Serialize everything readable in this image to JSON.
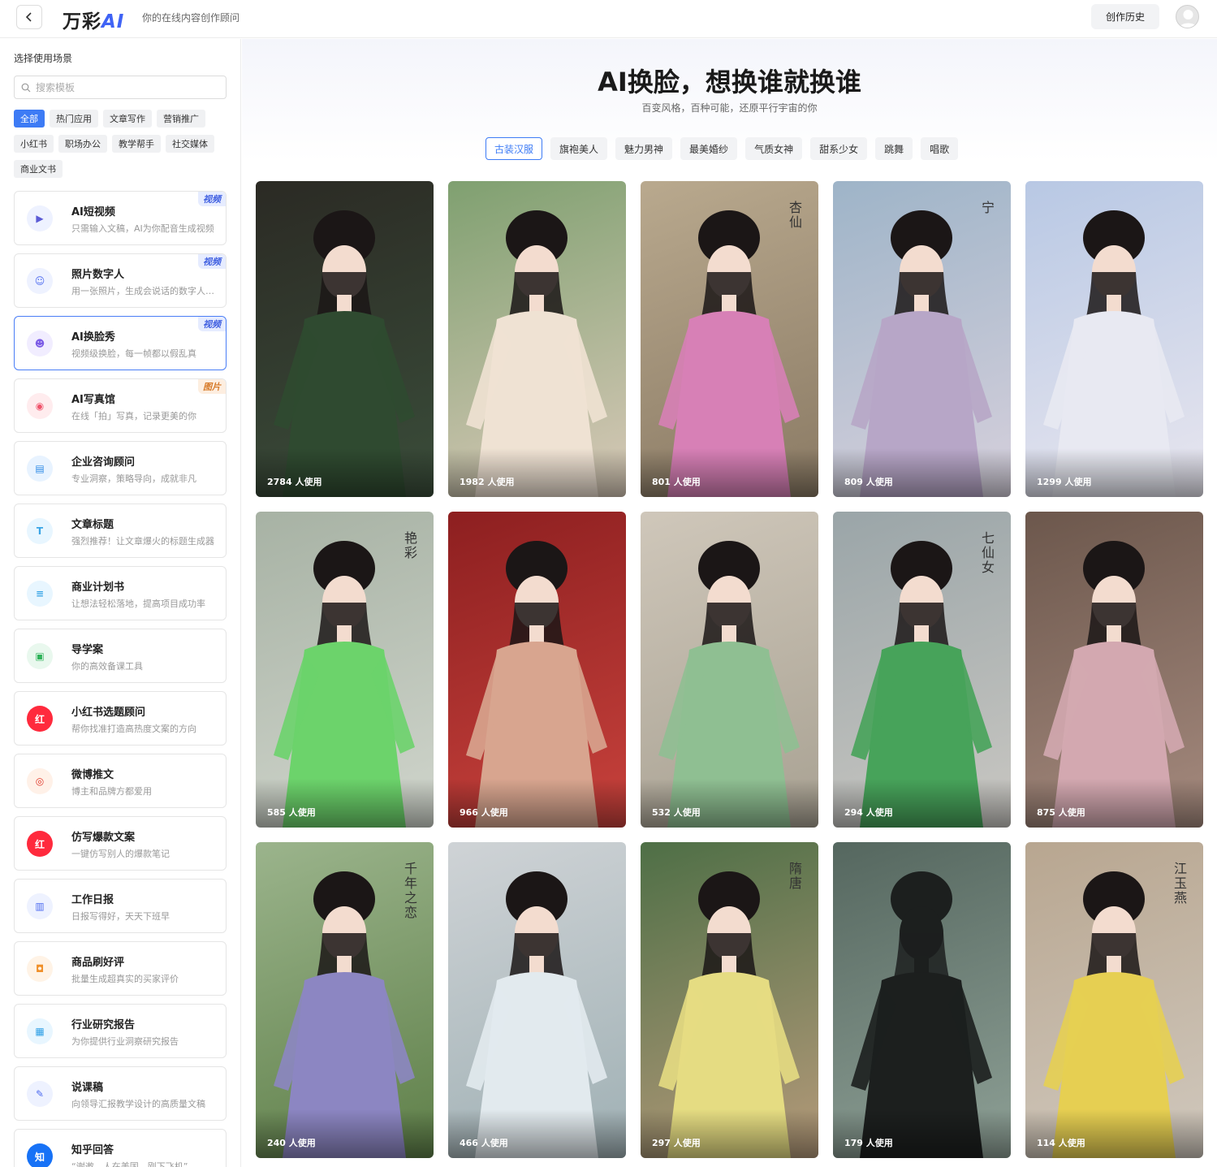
{
  "header": {
    "logo_text": "万彩",
    "logo_ai": "AI",
    "slogan": "你的在线内容创作顾问",
    "history_label": "创作历史"
  },
  "sidebar": {
    "title": "选择使用场景",
    "search_placeholder": "搜索模板",
    "filters": [
      "全部",
      "热门应用",
      "文章写作",
      "营销推广",
      "小红书",
      "职场办公",
      "教学帮手",
      "社交媒体",
      "商业文书"
    ],
    "active_filter": "全部",
    "cards": [
      {
        "title": "AI短视频",
        "desc": "只需输入文稿，AI为你配音生成视频",
        "badge": "视频",
        "icon": "play-icon"
      },
      {
        "title": "照片数字人",
        "desc": "用一张照片，生成会说话的数字人视...",
        "badge": "视频",
        "icon": "user-icon"
      },
      {
        "title": "AI换脸秀",
        "desc": "视频级换脸，每一帧都以假乱真",
        "badge": "视频",
        "icon": "face-icon"
      },
      {
        "title": "AI写真馆",
        "desc": "在线「拍」写真，记录更美的你",
        "badge": "图片",
        "icon": "camera-icon"
      },
      {
        "title": "企业咨询顾问",
        "desc": "专业洞察，策略导向，成就非凡",
        "badge": "",
        "icon": "briefcase-icon"
      },
      {
        "title": "文章标题",
        "desc": "强烈推荐！让文章爆火的标题生成器",
        "badge": "",
        "icon": "title-icon"
      },
      {
        "title": "商业计划书",
        "desc": "让想法轻松落地，提高项目成功率",
        "badge": "",
        "icon": "document-icon"
      },
      {
        "title": "导学案",
        "desc": "你的高效备课工具",
        "badge": "",
        "icon": "board-icon"
      },
      {
        "title": "小红书选题顾问",
        "desc": "帮你找准打造高热度文案的方向",
        "badge": "",
        "icon": "xiaohongshu-icon"
      },
      {
        "title": "微博推文",
        "desc": "博主和品牌方都爱用",
        "badge": "",
        "icon": "weibo-icon"
      },
      {
        "title": "仿写爆款文案",
        "desc": "一键仿写别人的爆款笔记",
        "badge": "",
        "icon": "xiaohongshu-icon"
      },
      {
        "title": "工作日报",
        "desc": "日报写得好，天天下班早",
        "badge": "",
        "icon": "report-icon"
      },
      {
        "title": "商品刷好评",
        "desc": "批量生成超真实的买家评价",
        "badge": "",
        "icon": "bag-icon"
      },
      {
        "title": "行业研究报告",
        "desc": "为你提供行业洞察研究报告",
        "badge": "",
        "icon": "research-icon"
      },
      {
        "title": "说课稿",
        "desc": "向领导汇报教学设计的高质量文稿",
        "badge": "",
        "icon": "teacher-icon"
      },
      {
        "title": "知乎回答",
        "desc": "“谢邀，人在美国，刚下飞机”",
        "badge": "",
        "icon": "zhihu-icon"
      }
    ]
  },
  "main": {
    "title": "AI换脸，想换谁就换谁",
    "subtitle": "百变风格，百种可能，还原平行宇宙的你",
    "tabs": [
      "古装汉服",
      "旗袍美人",
      "魅力男神",
      "最美婚纱",
      "气质女神",
      "甜系少女",
      "跳舞",
      "唱歌"
    ],
    "active_tab": "古装汉服",
    "tiles": [
      {
        "uses": "2784 人使用",
        "bg": [
          "#2b2a24",
          "#3a4d3a"
        ],
        "dress": "#2f4a30",
        "text": ""
      },
      {
        "uses": "1982 人使用",
        "bg": [
          "#7fa070",
          "#d8c9b8"
        ],
        "dress": "#efe2d3",
        "text": ""
      },
      {
        "uses": "801 人使用",
        "bg": [
          "#b9a98e",
          "#8a7a64"
        ],
        "dress": "#d780b6",
        "text": "杏仙"
      },
      {
        "uses": "809 人使用",
        "bg": [
          "#9eb4c8",
          "#d6d0dc"
        ],
        "dress": "#b7a6c7",
        "text": "宁"
      },
      {
        "uses": "1299 人使用",
        "bg": [
          "#b8c8e4",
          "#e8e6ef"
        ],
        "dress": "#e8e9f2",
        "text": ""
      },
      {
        "uses": "585 人使用",
        "bg": [
          "#a7b2a4",
          "#d0d5cc"
        ],
        "dress": "#6cd36b",
        "text": "艳彩"
      },
      {
        "uses": "966 人使用",
        "bg": [
          "#8d1f20",
          "#c8423c"
        ],
        "dress": "#d8a58f",
        "text": ""
      },
      {
        "uses": "532 人使用",
        "bg": [
          "#cfc7ba",
          "#a8a192"
        ],
        "dress": "#8fbf92",
        "text": ""
      },
      {
        "uses": "294 人使用",
        "bg": [
          "#9aa5a8",
          "#c9c7c2"
        ],
        "dress": "#47a35a",
        "text": "七仙女"
      },
      {
        "uses": "875 人使用",
        "bg": [
          "#6c574c",
          "#a58a7e"
        ],
        "dress": "#d3a8b0",
        "text": ""
      },
      {
        "uses": "240 人使用",
        "bg": [
          "#9bb48c",
          "#5e7f48"
        ],
        "dress": "#8c86c2",
        "text": "千年之恋"
      },
      {
        "uses": "466 人使用",
        "bg": [
          "#cfd3d6",
          "#9fb0b4"
        ],
        "dress": "#e2eaee",
        "text": ""
      },
      {
        "uses": "297 人使用",
        "bg": [
          "#4e6f46",
          "#b59a7a"
        ],
        "dress": "#e5dc82",
        "text": "隋唐"
      },
      {
        "uses": "179 人使用",
        "bg": [
          "#55675f",
          "#8ea096"
        ],
        "dress": "#1c1f1e",
        "text": ""
      },
      {
        "uses": "114 人使用",
        "bg": [
          "#b8a690",
          "#d0c8bd"
        ],
        "dress": "#e6cf52",
        "text": "江玉燕"
      }
    ]
  }
}
